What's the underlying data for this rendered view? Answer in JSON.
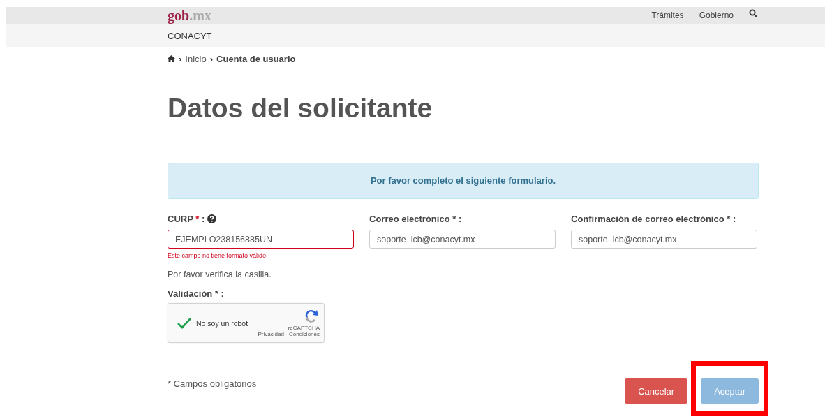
{
  "header": {
    "logo_main": "gob",
    "logo_suffix": ".mx",
    "links": [
      "Trámites",
      "Gobierno"
    ]
  },
  "subnav": {
    "title": "CONACYT"
  },
  "breadcrumb": [
    {
      "separator": "›",
      "label": "Inicio",
      "current": false
    },
    {
      "separator": "›",
      "label": "Cuenta de usuario",
      "current": true
    }
  ],
  "page_title": "Datos del solicitante",
  "alert": "Por favor completo el siguiente formulario.",
  "fields": [
    {
      "label": "CURP",
      "marker": "*",
      "suffix": ":",
      "help": true,
      "value": "EJEMPLO238156885UN",
      "invalid": true,
      "error": "Este campo no tiene formato válido"
    },
    {
      "label": "Correo electrónico",
      "marker": "*",
      "suffix": ":",
      "help": false,
      "value": "soporte_icb@conacyt.mx",
      "invalid": false
    },
    {
      "label": "Confirmación de correo electrónico",
      "marker": "*",
      "suffix": ":",
      "help": false,
      "value": "soporte_icb@conacyt.mx",
      "invalid": false
    }
  ],
  "captcha_note": "Por favor verifica la casilla.",
  "validation_label": "Validación *",
  "validation_sep": ":",
  "captcha": {
    "checked": true,
    "label": "No soy un robot",
    "brand": "reCAPTCHA",
    "links": "Privacidad - Condiciones"
  },
  "required_note": "* Campos obligatorios",
  "buttons": [
    {
      "label": "Cancelar",
      "kind": "danger",
      "disabled": false,
      "highlighted": false
    },
    {
      "label": "Aceptar",
      "kind": "primary",
      "disabled": true,
      "highlighted": true
    }
  ]
}
